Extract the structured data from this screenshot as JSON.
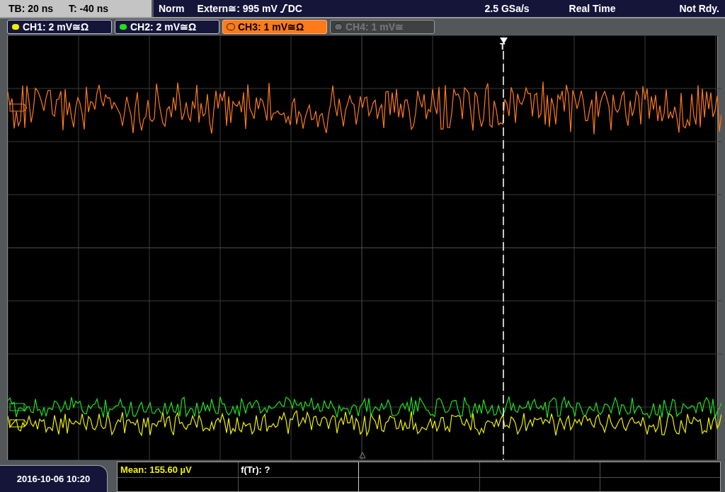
{
  "top_bar": {
    "timebase": "TB: 20 ns",
    "trigger_time": "T: -40 ns",
    "trigger_mode": "Norm",
    "trigger_source": "Extern≅: 995 mV",
    "trigger_coupling": "DC",
    "sample_rate": "2.5 GSa/s",
    "acquisition_mode": "Real Time",
    "status": "Not Rdy."
  },
  "channels": [
    {
      "label": "CH1: 2 mV≅Ω",
      "color": "#f0f000",
      "selected": false,
      "enabled": true
    },
    {
      "label": "CH2: 2 mV≅Ω",
      "color": "#20e020",
      "selected": false,
      "enabled": true
    },
    {
      "label": "CH3: 1 mV≅Ω",
      "color": "#ff7a1a",
      "selected": true,
      "enabled": true
    },
    {
      "label": "CH4: 1 mV≅",
      "color": "#6a6a6a",
      "selected": false,
      "enabled": false
    }
  ],
  "trigger_marker": {
    "label": "T"
  },
  "measurements": [
    {
      "text": "Mean: 155.60 µV",
      "kind": "channel"
    },
    {
      "text": "f(Tr): ?",
      "kind": "info"
    }
  ],
  "date": "2016-10-06 10:20"
}
